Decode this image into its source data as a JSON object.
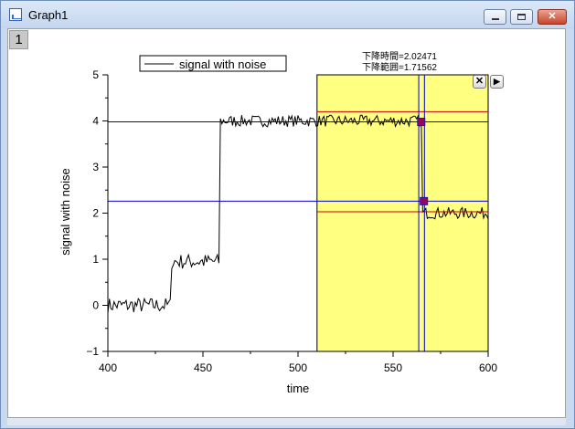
{
  "window": {
    "title": "Graph1",
    "layer_label": "1",
    "icon": "graph-window-icon",
    "controls": [
      "minimize-icon",
      "maximize-icon",
      "close-icon"
    ]
  },
  "annotation": {
    "line1": "下降時間=2.02471",
    "line2": "下降範囲=1.71562"
  },
  "gadget": {
    "close_icon": "close-icon",
    "close_glyph": "✕",
    "next_icon": "play-icon",
    "next_glyph": "▶"
  },
  "colors": {
    "signal": "#000000",
    "roi_fill": "#ffff80",
    "marker_lines": "#0000cc",
    "level_lines": "#cc0000",
    "marker_points": "#990066"
  },
  "chart_data": {
    "type": "line",
    "xlabel": "time",
    "ylabel": "signal with noise",
    "xlim": [
      400,
      600
    ],
    "ylim": [
      -1,
      5
    ],
    "xticks": [
      400,
      450,
      500,
      550,
      600
    ],
    "yticks": [
      -1,
      0,
      1,
      2,
      3,
      4,
      5
    ],
    "legend": {
      "position": "top-left",
      "entries": [
        "signal with noise"
      ]
    },
    "series": [
      {
        "name": "signal with noise",
        "segments": [
          {
            "x_from": 400,
            "x_to": 433,
            "level": 0.0,
            "noise": 0.12
          },
          {
            "x_from": 433,
            "x_to": 459,
            "level": 0.95,
            "noise": 0.12
          },
          {
            "x_from": 459,
            "x_to": 565,
            "level": 4.0,
            "noise": 0.09
          },
          {
            "x_from": 565,
            "x_to": 600,
            "level": 2.0,
            "noise": 0.09
          }
        ]
      }
    ],
    "roi": {
      "x_from": 510,
      "x_to": 600
    },
    "horizontal_lines": [
      {
        "y": 3.98,
        "color": "blue"
      },
      {
        "y": 2.26,
        "color": "blue"
      },
      {
        "y": 4.2,
        "color": "red",
        "x_from": 510
      },
      {
        "y": 2.03,
        "color": "red",
        "x_from": 510
      }
    ],
    "vertical_lines": [
      {
        "x": 563.5,
        "color": "blue"
      },
      {
        "x": 566.5,
        "color": "blue"
      }
    ],
    "markers": [
      {
        "x": 564.8,
        "y": 3.98
      },
      {
        "x": 566.2,
        "y": 2.26
      }
    ],
    "fall_time": 2.02471,
    "fall_range": 1.71562
  }
}
